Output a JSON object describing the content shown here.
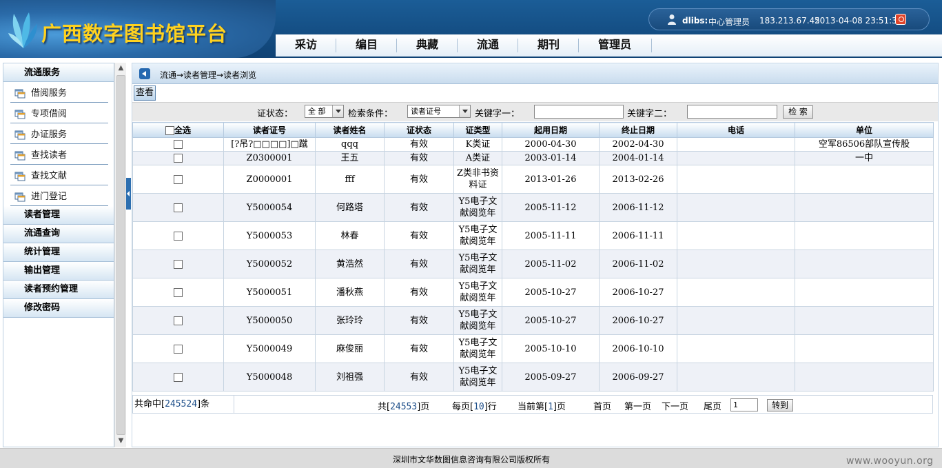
{
  "header": {
    "logo_text": "广西数字图书馆平台",
    "user": {
      "name": "dlibs:",
      "role": "中心管理员",
      "ip": "183.213.67.45",
      "datetime": "2013-04-08 23:51:35"
    }
  },
  "nav": [
    {
      "label": "采访"
    },
    {
      "label": "编目"
    },
    {
      "label": "典藏"
    },
    {
      "label": "流通"
    },
    {
      "label": "期刊"
    },
    {
      "label": "管理员"
    }
  ],
  "sidebar": {
    "head": "流通服务",
    "items": [
      {
        "label": "借阅服务"
      },
      {
        "label": "专项借阅"
      },
      {
        "label": "办证服务"
      },
      {
        "label": "查找读者"
      },
      {
        "label": "查找文献"
      },
      {
        "label": "进门登记"
      }
    ],
    "sections": [
      {
        "label": "读者管理"
      },
      {
        "label": "流通查询"
      },
      {
        "label": "统计管理"
      },
      {
        "label": "输出管理"
      },
      {
        "label": "读者预约管理"
      },
      {
        "label": "修改密码"
      }
    ]
  },
  "breadcrumb": "流通→读者管理→读者浏览",
  "view_button": "查看",
  "filter": {
    "status_label": "证状态：",
    "status_value": "全 部",
    "condition_label": "检索条件：",
    "condition_value": "读者证号",
    "kw1_label": "关键字一：",
    "kw1_value": "",
    "kw2_label": "关键字二：",
    "kw2_value": "",
    "search_button": "检 索"
  },
  "table": {
    "select_all": "全选",
    "headers": [
      "读者证号",
      "读者姓名",
      "证状态",
      "证类型",
      "起用日期",
      "终止日期",
      "电话",
      "单位"
    ],
    "rows": [
      {
        "id": "[?吊?□□□□]□蹴",
        "name": "qqq",
        "status": "有效",
        "type": "K类证",
        "start": "2000-04-30",
        "end": "2002-04-30",
        "phone": "",
        "unit": "空军86506部队宣传股"
      },
      {
        "id": "Z0300001",
        "name": "王五",
        "status": "有效",
        "type": "A类证",
        "start": "2003-01-14",
        "end": "2004-01-14",
        "phone": "",
        "unit": "一中"
      },
      {
        "id": "Z0000001",
        "name": "fff",
        "status": "有效",
        "type": "Z类非书资料证",
        "start": "2013-01-26",
        "end": "2013-02-26",
        "phone": "",
        "unit": ""
      },
      {
        "id": "Y5000054",
        "name": "何路塔",
        "status": "有效",
        "type": "Y5电子文献阅览年",
        "start": "2005-11-12",
        "end": "2006-11-12",
        "phone": "",
        "unit": ""
      },
      {
        "id": "Y5000053",
        "name": "林春",
        "status": "有效",
        "type": "Y5电子文献阅览年",
        "start": "2005-11-11",
        "end": "2006-11-11",
        "phone": "",
        "unit": ""
      },
      {
        "id": "Y5000052",
        "name": "黄浩然",
        "status": "有效",
        "type": "Y5电子文献阅览年",
        "start": "2005-11-02",
        "end": "2006-11-02",
        "phone": "",
        "unit": ""
      },
      {
        "id": "Y5000051",
        "name": "潘秋燕",
        "status": "有效",
        "type": "Y5电子文献阅览年",
        "start": "2005-10-27",
        "end": "2006-10-27",
        "phone": "",
        "unit": ""
      },
      {
        "id": "Y5000050",
        "name": "张玲玲",
        "status": "有效",
        "type": "Y5电子文献阅览年",
        "start": "2005-10-27",
        "end": "2006-10-27",
        "phone": "",
        "unit": ""
      },
      {
        "id": "Y5000049",
        "name": "麻俊丽",
        "status": "有效",
        "type": "Y5电子文献阅览年",
        "start": "2005-10-10",
        "end": "2006-10-10",
        "phone": "",
        "unit": ""
      },
      {
        "id": "Y5000048",
        "name": "刘祖强",
        "status": "有效",
        "type": "Y5电子文献阅览年",
        "start": "2005-09-27",
        "end": "2006-09-27",
        "phone": "",
        "unit": ""
      }
    ]
  },
  "pager": {
    "total_prefix": "共命中[",
    "total_count": "245524",
    "total_suffix": "]条",
    "pages_prefix": "共[",
    "pages_count": "24553",
    "pages_suffix": "]页",
    "per_page_prefix": "每页[",
    "per_page": "10",
    "per_page_suffix": "]行",
    "current_prefix": "当前第[",
    "current_page": "1",
    "current_suffix": "]页",
    "first": "首页",
    "prev": "第一页",
    "next": "下一页",
    "last": "尾页",
    "page_input": "1",
    "goto_button": "转到"
  },
  "footer": {
    "copyright": "深圳市文华数图信息咨询有限公司版权所有",
    "watermark": "www.wooyun.org"
  },
  "colors": {
    "header_blue": "#0f4274",
    "logo_yellow": "#ffd21f",
    "page_link": "#1d4e89"
  }
}
